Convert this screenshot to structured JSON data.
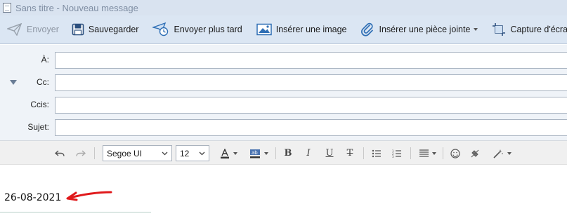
{
  "window": {
    "title": "Sans titre - Nouveau message"
  },
  "toolbar": {
    "send": "Envoyer",
    "save": "Sauvegarder",
    "send_later": "Envoyer plus tard",
    "insert_image": "Insérer une image",
    "insert_attachment": "Insérer une pièce jointe",
    "screenshot": "Capture d'écran"
  },
  "fields": {
    "to_label": "À:",
    "cc_label": "Cc:",
    "bcc_label": "Ccis:",
    "subject_label": "Sujet:",
    "to_value": "",
    "cc_value": "",
    "bcc_value": "",
    "subject_value": ""
  },
  "format": {
    "font": "Segoe UI",
    "size": "12"
  },
  "body": {
    "text": "26-08-2021"
  },
  "colors": {
    "toolbar_bg": "#dbe6f3",
    "accent_icon": "#2f6fb5",
    "annotation_arrow": "#e0191b"
  }
}
